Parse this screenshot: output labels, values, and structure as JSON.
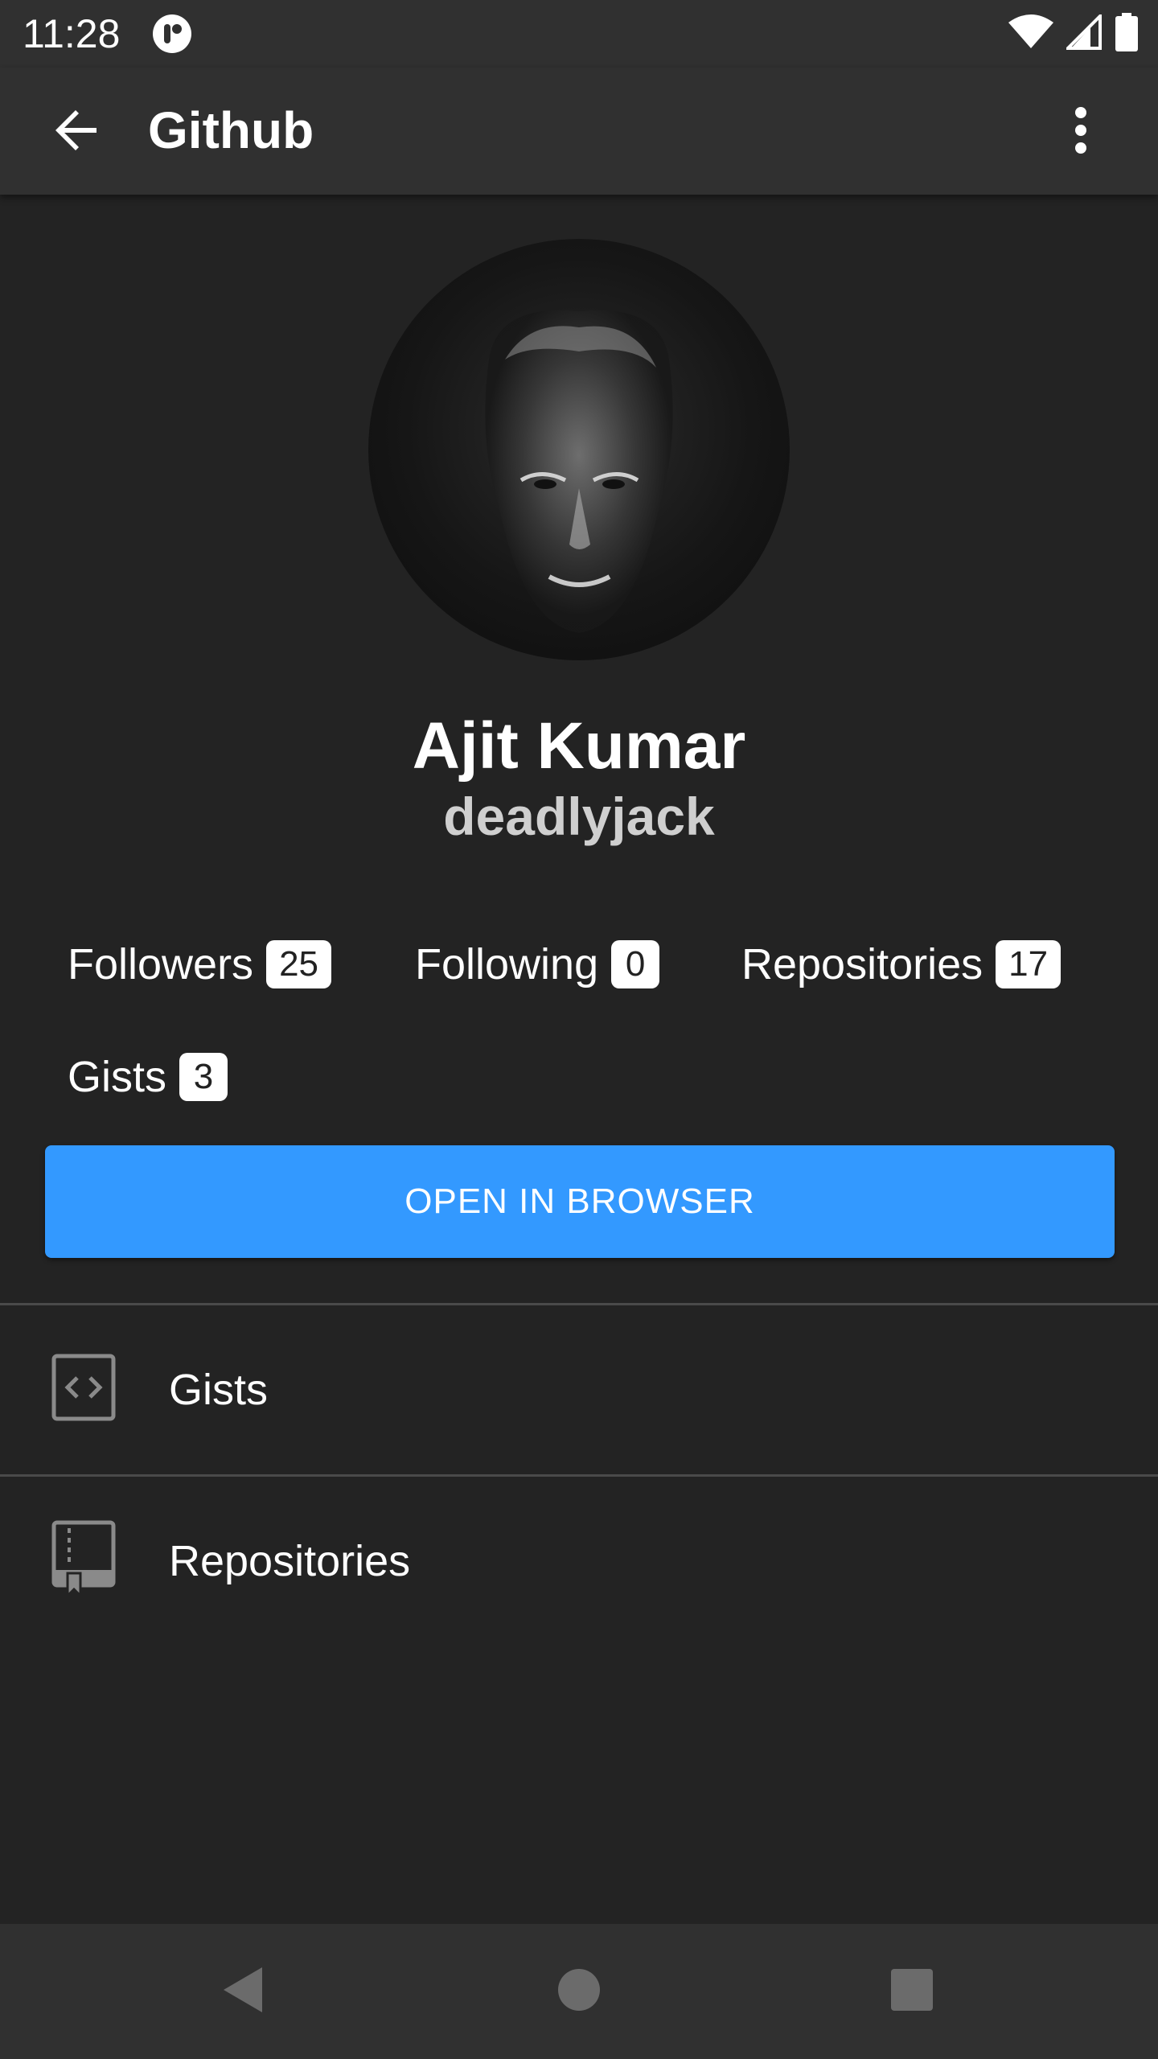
{
  "status_bar": {
    "time": "11:28",
    "icons": [
      "app-notification-icon",
      "wifi-icon",
      "cell-signal-icon",
      "battery-icon"
    ]
  },
  "app_bar": {
    "title": "Github",
    "back_icon": "arrow-left-icon",
    "menu_icon": "more-vert-icon"
  },
  "profile": {
    "full_name": "Ajit Kumar",
    "username": "deadlyjack"
  },
  "stats": {
    "followers": {
      "label": "Followers",
      "count": "25"
    },
    "following": {
      "label": "Following",
      "count": "0"
    },
    "repositories": {
      "label": "Repositories",
      "count": "17"
    },
    "gists": {
      "label": "Gists",
      "count": "3"
    }
  },
  "open_button": {
    "label": "OPEN IN BROWSER"
  },
  "list": [
    {
      "label": "Gists",
      "icon": "code-file-icon"
    },
    {
      "label": "Repositories",
      "icon": "repo-book-icon"
    }
  ],
  "colors": {
    "background": "#232323",
    "bar": "#303030",
    "accent": "#3399ff",
    "icon_gray": "#8a8a8a"
  },
  "nav_bar": {
    "icons": [
      "nav-back-icon",
      "nav-home-icon",
      "nav-recents-icon"
    ]
  }
}
